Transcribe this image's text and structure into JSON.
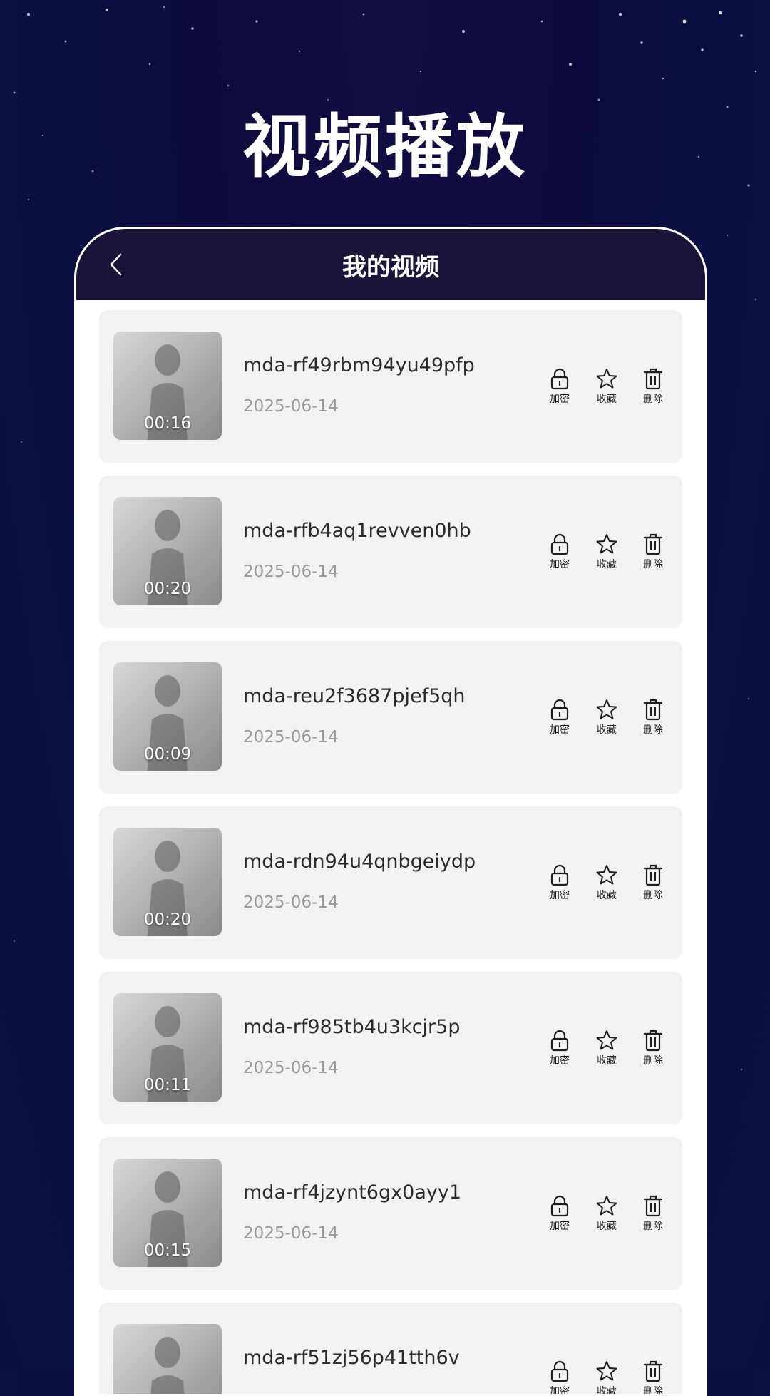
{
  "page": {
    "title": "视频播放"
  },
  "panel": {
    "title": "我的视频"
  },
  "videos": [
    {
      "name": "mda-rf49rbm94yu49pfp",
      "date": "2025-06-14",
      "duration": "00:16"
    },
    {
      "name": "mda-rfb4aq1revven0hb",
      "date": "2025-06-14",
      "duration": "00:20"
    },
    {
      "name": "mda-reu2f3687pjef5qh",
      "date": "2025-06-14",
      "duration": "00:09"
    },
    {
      "name": "mda-rdn94u4qnbgeiydp",
      "date": "2025-06-14",
      "duration": "00:20"
    },
    {
      "name": "mda-rf985tb4u3kcjr5p",
      "date": "2025-06-14",
      "duration": "00:11"
    },
    {
      "name": "mda-rf4jzynt6gx0ayy1",
      "date": "2025-06-14",
      "duration": "00:15"
    },
    {
      "name": "mda-rf51zj56p41tth6v",
      "date": "",
      "duration": ""
    }
  ],
  "actions": {
    "encrypt": "加密",
    "favorite": "收藏",
    "delete": "删除"
  },
  "icons": {
    "back": "chevron-left-icon",
    "encrypt": "lock-icon",
    "favorite": "star-icon",
    "delete": "trash-icon"
  },
  "colors": {
    "background": "#0b0a3a",
    "header": "#1a1538",
    "card": "#f2f2f2",
    "date": "#9a9a9a"
  }
}
